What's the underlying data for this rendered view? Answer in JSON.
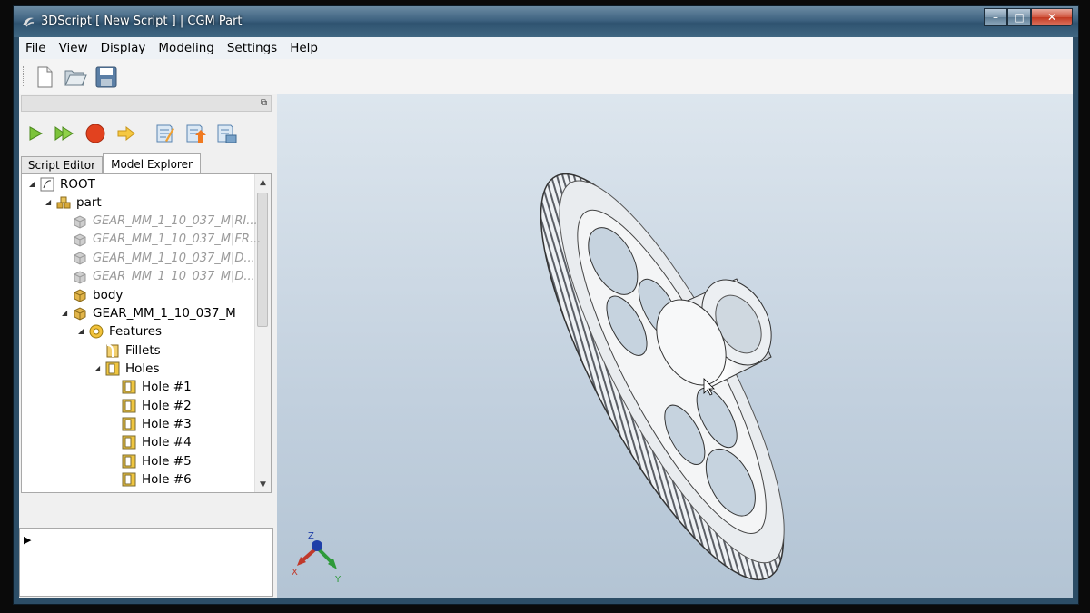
{
  "window": {
    "title": "3DScript [ New Script ] | CGM Part",
    "controls": {
      "minimize": "–",
      "maximize": "□",
      "close": "✕"
    }
  },
  "menu": [
    "File",
    "View",
    "Display",
    "Modeling",
    "Settings",
    "Help"
  ],
  "toolbar": [
    "new-file-icon",
    "open-folder-icon",
    "save-icon"
  ],
  "script_toolbar": [
    "run-icon",
    "run-step-icon",
    "stop-icon",
    "next-arrow-icon",
    "edit-script-icon",
    "export-script-icon",
    "script-settings-icon"
  ],
  "tabs": [
    {
      "label": "Script Editor",
      "active": false
    },
    {
      "label": "Model Explorer",
      "active": true
    }
  ],
  "tree": [
    {
      "label": "ROOT",
      "level": 0,
      "expanded": true,
      "icon": "root-icon",
      "dim": false
    },
    {
      "label": "part",
      "level": 1,
      "expanded": true,
      "icon": "part-icon",
      "dim": false
    },
    {
      "label": "GEAR_MM_1_10_037_M|RI...",
      "level": 2,
      "expanded": null,
      "icon": "body-gray-icon",
      "dim": true
    },
    {
      "label": "GEAR_MM_1_10_037_M|FR...",
      "level": 2,
      "expanded": null,
      "icon": "body-gray-icon",
      "dim": true
    },
    {
      "label": "GEAR_MM_1_10_037_M|D...",
      "level": 2,
      "expanded": null,
      "icon": "body-gray-icon",
      "dim": true
    },
    {
      "label": "GEAR_MM_1_10_037_M|D...",
      "level": 2,
      "expanded": null,
      "icon": "body-gray-icon",
      "dim": true
    },
    {
      "label": "body",
      "level": 2,
      "expanded": null,
      "icon": "body-icon",
      "dim": false
    },
    {
      "label": "GEAR_MM_1_10_037_M",
      "level": 2,
      "expanded": true,
      "icon": "body-icon",
      "dim": false
    },
    {
      "label": "Features",
      "level": 3,
      "expanded": true,
      "icon": "features-icon",
      "dim": false
    },
    {
      "label": "Fillets",
      "level": 4,
      "expanded": null,
      "icon": "fillet-icon",
      "dim": false
    },
    {
      "label": "Holes",
      "level": 4,
      "expanded": true,
      "icon": "hole-icon",
      "dim": false
    },
    {
      "label": "Hole #1",
      "level": 5,
      "expanded": null,
      "icon": "hole-icon",
      "dim": false
    },
    {
      "label": "Hole #2",
      "level": 5,
      "expanded": null,
      "icon": "hole-icon",
      "dim": false
    },
    {
      "label": "Hole #3",
      "level": 5,
      "expanded": null,
      "icon": "hole-icon",
      "dim": false
    },
    {
      "label": "Hole #4",
      "level": 5,
      "expanded": null,
      "icon": "hole-icon",
      "dim": false
    },
    {
      "label": "Hole #5",
      "level": 5,
      "expanded": null,
      "icon": "hole-icon",
      "dim": false
    },
    {
      "label": "Hole #6",
      "level": 5,
      "expanded": null,
      "icon": "hole-icon",
      "dim": false
    }
  ],
  "axis": {
    "x": "X",
    "y": "Y",
    "z": "Z"
  },
  "colors": {
    "title_bar": "#3e6280",
    "viewport": "#c9d6e3",
    "close_button": "#c8452e"
  }
}
